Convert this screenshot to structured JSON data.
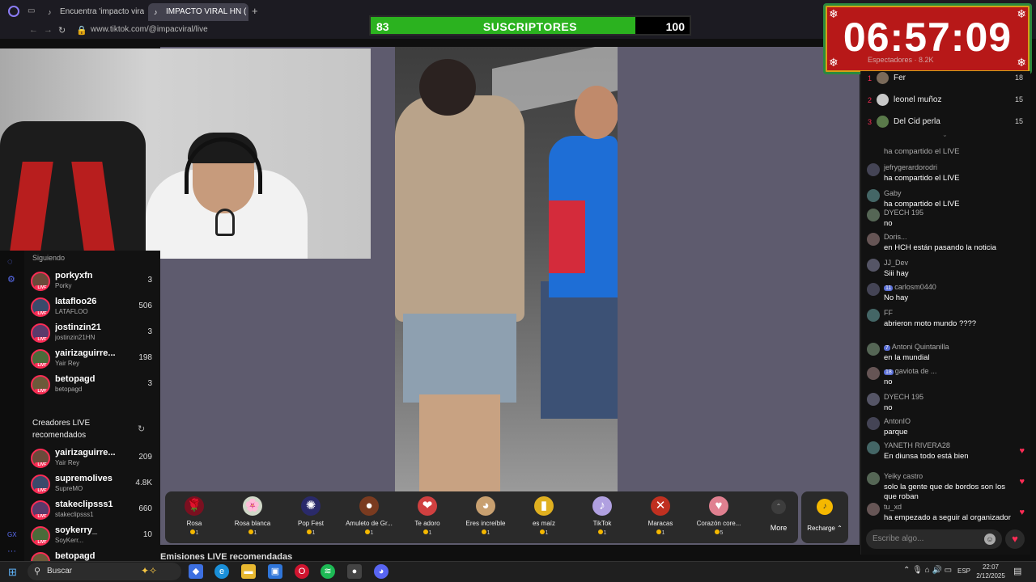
{
  "browser": {
    "tabs": [
      {
        "label": "Encuentra 'impacto viral'"
      },
      {
        "label": "IMPACTO VIRAL HN ("
      }
    ],
    "url": "www.tiktok.com/@impacviral/live"
  },
  "overlay": {
    "subscribers": {
      "current": 83,
      "goal": 100,
      "label": "SUSCRIPTORES",
      "progress": 0.83
    },
    "timer": "06:57:09",
    "spectators_label": "Espectadores · 8.2K"
  },
  "sidebar": {
    "following_label": "Siguiendo",
    "following": [
      {
        "name": "porkyxfn",
        "sub": "Porky",
        "count": "3"
      },
      {
        "name": "latafloo26",
        "sub": "LATAFLOO",
        "count": "506"
      },
      {
        "name": "jostinzin21",
        "sub": "jostinzin21HN",
        "count": "3"
      },
      {
        "name": "yairizaguirre...",
        "sub": "Yair Rey",
        "count": "198"
      },
      {
        "name": "betopagd",
        "sub": "betopagd",
        "count": "3"
      }
    ],
    "recommended_title": "Creadores LIVE recomendados",
    "recommended": [
      {
        "name": "yairizaguirre...",
        "sub": "Yair Rey",
        "count": "209"
      },
      {
        "name": "supremolives",
        "sub": "SupreMO",
        "count": "4.8K"
      },
      {
        "name": "stakeclipsss1",
        "sub": "stakeclipsss1",
        "count": "660"
      },
      {
        "name": "soykerry_",
        "sub": "SoyKerr...",
        "count": "10"
      },
      {
        "name": "betopagd",
        "sub": "",
        "count": ""
      }
    ]
  },
  "gifts": [
    {
      "name": "Rosa",
      "price": "1",
      "icon": "🌹",
      "color": "#7a1020"
    },
    {
      "name": "Rosa blanca",
      "price": "1",
      "icon": "🌸",
      "color": "#d0d8c8"
    },
    {
      "name": "Pop Fest",
      "price": "1",
      "icon": "✺",
      "color": "#2a2a6a"
    },
    {
      "name": "Amuleto de Gr...",
      "price": "1",
      "icon": "●",
      "color": "#7a3b20"
    },
    {
      "name": "Te adoro",
      "price": "1",
      "icon": "❤",
      "color": "#d04040"
    },
    {
      "name": "Eres increíble",
      "price": "1",
      "icon": "◕",
      "color": "#c8a070"
    },
    {
      "name": "es maíz",
      "price": "1",
      "icon": "▮",
      "color": "#e0b020"
    },
    {
      "name": "TikTok",
      "price": "1",
      "icon": "♪",
      "color": "#b0a0e0"
    },
    {
      "name": "Maracas",
      "price": "1",
      "icon": "✕",
      "color": "#c03020"
    },
    {
      "name": "Corazón core...",
      "price": "5",
      "icon": "♥",
      "color": "#e08090"
    }
  ],
  "more_label": "More",
  "recharge_label": "Recharge",
  "recommended_streams_title": "Emisiones LIVE recomendadas",
  "ranking": [
    {
      "rank": "1",
      "name": "Fer",
      "score": "18"
    },
    {
      "rank": "2",
      "name": "leonel muñoz",
      "score": "15"
    },
    {
      "rank": "3",
      "name": "Del Cid perla",
      "score": "15"
    }
  ],
  "chat": [
    {
      "user": "",
      "text": "ha compartido el LIVE"
    },
    {
      "user": "jefrygerardorodri",
      "text": "ha compartido el LIVE"
    },
    {
      "user": "Gaby",
      "text": "ha compartido el LIVE"
    },
    {
      "user": "DYECH 195",
      "text": "no"
    },
    {
      "user": "Doris...",
      "text": "en HCH están pasando la noticia"
    },
    {
      "user": "JJ_Dev",
      "text": "Siii hay"
    },
    {
      "user": "carlosm0440",
      "text": "No hay",
      "badge": "11"
    },
    {
      "user": "FF",
      "text": "abrieron moto mundo ????"
    },
    {
      "user": "Antoni Quintanilla",
      "text": "en la mundial",
      "badge": "7"
    },
    {
      "user": "gaviota de ...",
      "text": "no",
      "badge": "18"
    },
    {
      "user": "DYECH 195",
      "text": "no"
    },
    {
      "user": "AntonIO",
      "text": "parque"
    },
    {
      "user": "YANETH RIVERA28",
      "text": "En diunsa todo está bien"
    },
    {
      "user": "Yeiky castro",
      "text": "solo la gente que de bordos son los que roban"
    },
    {
      "user": "tu_xd",
      "text": "ha empezado a seguir al organizador"
    }
  ],
  "chat_input_placeholder": "Escribe algo...",
  "taskbar": {
    "search_label": "Buscar",
    "lang": "ESP",
    "time": "22:07",
    "date": "2/12/2025"
  }
}
